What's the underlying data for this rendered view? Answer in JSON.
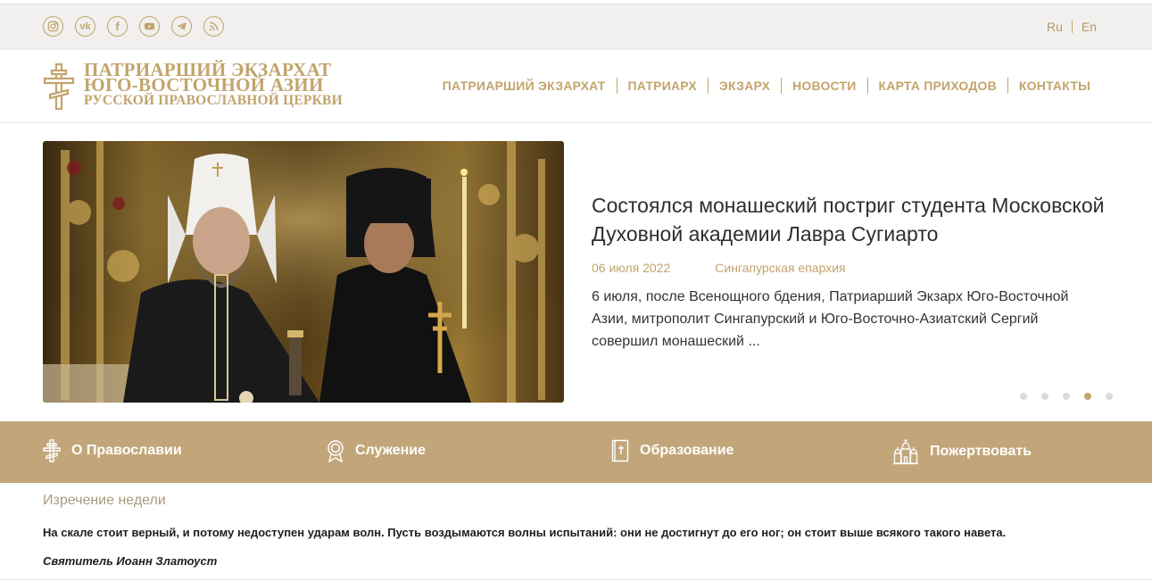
{
  "colors": {
    "gold": "#c2a46c",
    "band": "#c2a67a",
    "topbar": "#f1f0ee",
    "text": "#333333"
  },
  "social": [
    {
      "icon": "instagram-icon"
    },
    {
      "icon": "vk-icon",
      "label": "vk"
    },
    {
      "icon": "facebook-icon",
      "label": "f"
    },
    {
      "icon": "youtube-icon"
    },
    {
      "icon": "telegram-icon"
    },
    {
      "icon": "rss-icon"
    }
  ],
  "lang": {
    "ru": "Ru",
    "en": "En"
  },
  "logo": {
    "line1": "ПАТРИАРШИЙ ЭКЗАРХАТ",
    "line2": "ЮГО-ВОСТОЧНОЙ АЗИИ",
    "line3": "РУССКОЙ ПРАВОСЛАВНОЙ ЦЕРКВИ"
  },
  "nav": {
    "items": [
      {
        "label": "ПАТРИАРШИЙ ЭКЗАРХАТ"
      },
      {
        "label": "ПАТРИАРХ"
      },
      {
        "label": "ЭКЗАРХ"
      },
      {
        "label": "НОВОСТИ"
      },
      {
        "label": "КАРТА ПРИХОДОВ"
      },
      {
        "label": "КОНТАКТЫ"
      }
    ]
  },
  "slide": {
    "title": "Состоялся монашеский постриг студента Московской Духовной академии Лавра Сугиарто",
    "date": "06 июля 2022",
    "category": "Сингапурская епархия",
    "excerpt": "6 июля, после Всенощного бдения, Патриарший Экзарх Юго-Восточной Азии, митрополит Сингапурский и Юго-Восточно-Азиатский Сергий совершил монашеский ...",
    "dots_total": 5,
    "active_dot": 4
  },
  "band": {
    "items": [
      {
        "label": "О Православии",
        "icon": "cross-icon"
      },
      {
        "label": "Служение",
        "icon": "medal-icon"
      },
      {
        "label": "Образование",
        "icon": "book-icon"
      },
      {
        "label": "Пожертвовать",
        "icon": "church-icon"
      }
    ]
  },
  "quote": {
    "heading": "Изречение недели",
    "text": "На скале стоит верный, и потому недоступен ударам волн. Пусть воздымаются волны испытаний: они не достигнут до его ног; он стоит выше всякого такого навета.",
    "author": "Святитель Иоанн Златоуст"
  }
}
